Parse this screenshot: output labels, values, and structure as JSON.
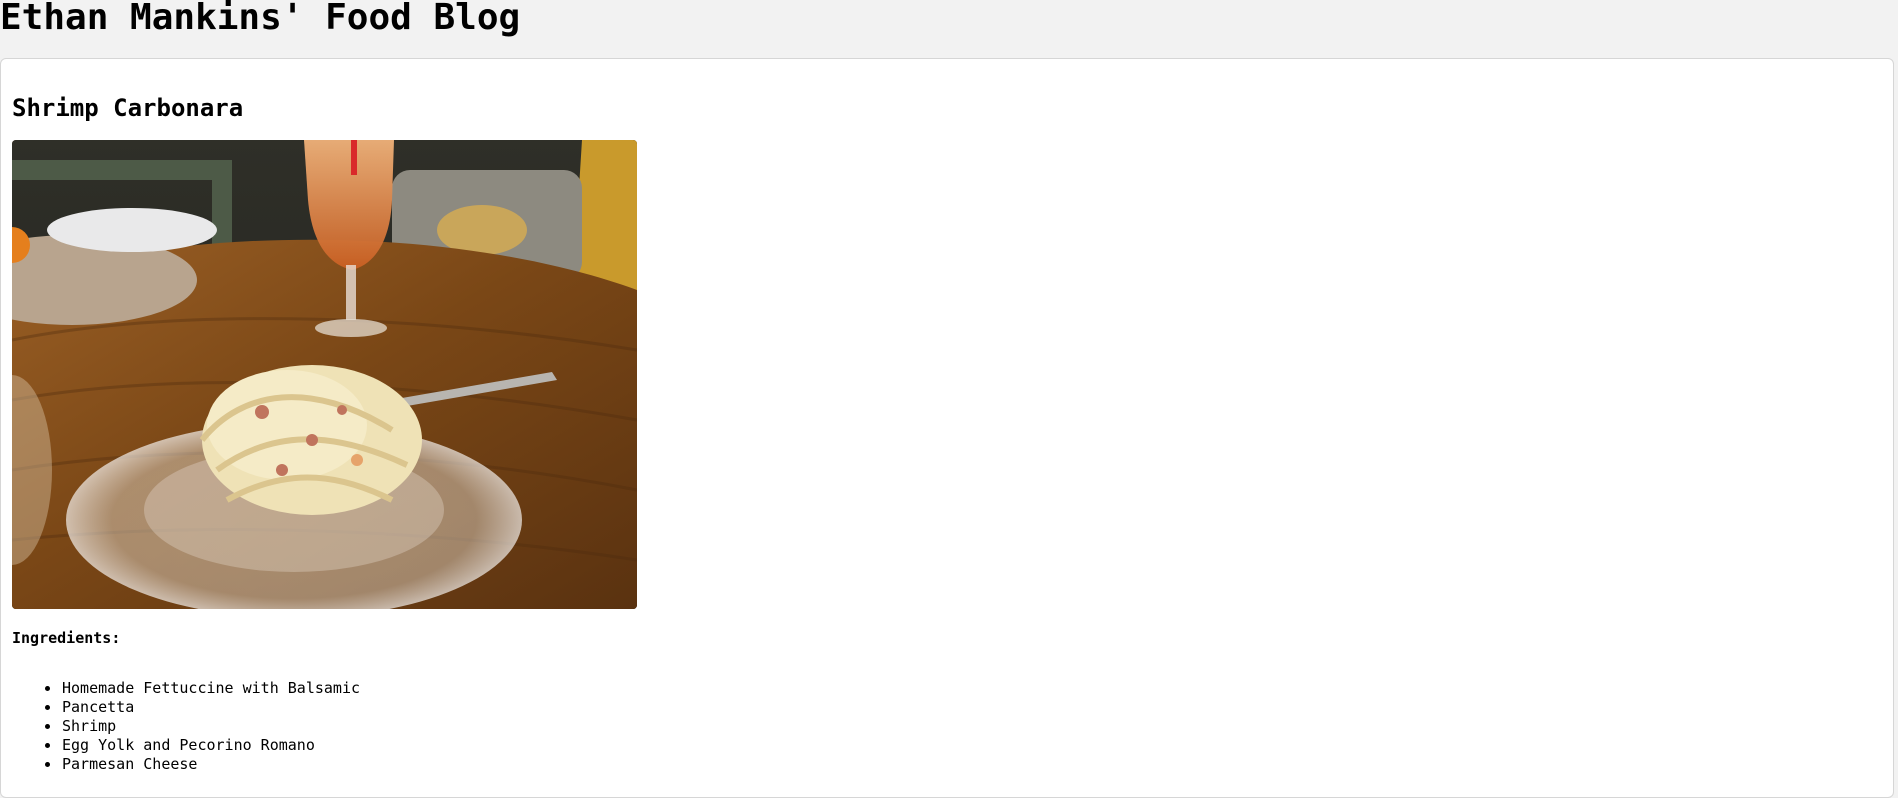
{
  "header": {
    "site_title": "Ethan Mankins' Food Blog"
  },
  "post": {
    "title": "Shrimp Carbonara",
    "ingredients_heading": "Ingredients:",
    "ingredients": [
      "Homemade Fettuccine with Balsamic",
      "Pancetta",
      "Shrimp",
      "Egg Yolk and Pecorino Romano",
      "Parmesan Cheese"
    ]
  }
}
